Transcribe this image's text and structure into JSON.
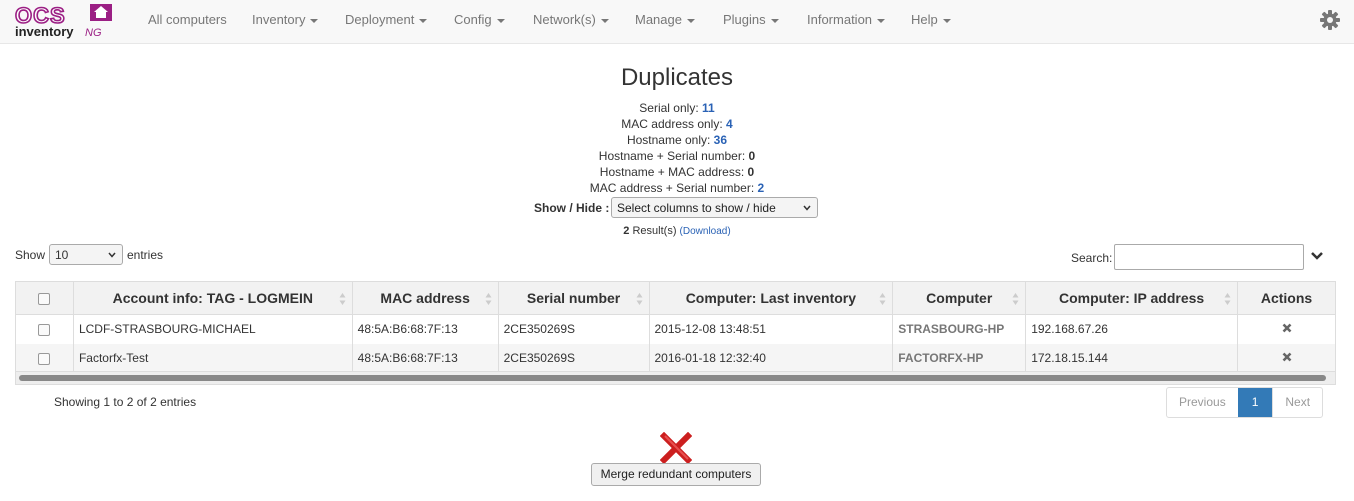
{
  "nav": {
    "logo_text_1": "OCS",
    "logo_text_2": "inventory",
    "logo_text_3": "NG",
    "items": [
      {
        "label": "All computers",
        "dropdown": false
      },
      {
        "label": "Inventory",
        "dropdown": true
      },
      {
        "label": "Deployment",
        "dropdown": true
      },
      {
        "label": "Config",
        "dropdown": true
      },
      {
        "label": "Network(s)",
        "dropdown": true
      },
      {
        "label": "Manage",
        "dropdown": true
      },
      {
        "label": "Plugins",
        "dropdown": true
      },
      {
        "label": "Information",
        "dropdown": true
      },
      {
        "label": "Help",
        "dropdown": true
      }
    ],
    "settings_icon": "gear-icon"
  },
  "page": {
    "title": "Duplicates",
    "stats": [
      {
        "label": "Serial only: ",
        "value": "11",
        "link": true
      },
      {
        "label": "MAC address only: ",
        "value": "4",
        "link": true
      },
      {
        "label": "Hostname only: ",
        "value": "36",
        "link": true
      },
      {
        "label": "Hostname + Serial number: ",
        "value": "0",
        "link": false
      },
      {
        "label": "Hostname + MAC address: ",
        "value": "0",
        "link": false
      },
      {
        "label": "MAC address + Serial number: ",
        "value": "2",
        "link": true
      }
    ],
    "show_hide_label": "Show / Hide :",
    "show_hide_select": "Select columns to show / hide",
    "results_count": "2",
    "results_label": " Result(s) ",
    "download_label": "(Download)"
  },
  "table_controls": {
    "show_label": "Show",
    "entries_value": "10",
    "entries_label": "entries",
    "search_label": "Search:"
  },
  "table": {
    "headers": [
      "Account info: TAG - LOGMEIN",
      "MAC address",
      "Serial number",
      "Computer: Last inventory",
      "Computer",
      "Computer: IP address",
      "Actions"
    ],
    "rows": [
      {
        "account": "LCDF-STRASBOURG-MICHAEL",
        "mac": "48:5A:B6:68:7F:13",
        "serial": "2CE350269S",
        "last_inventory": "2015-12-08 13:48:51",
        "computer": "STRASBOURG-HP",
        "ip": "192.168.67.26"
      },
      {
        "account": "Factorfx-Test",
        "mac": "48:5A:B6:68:7F:13",
        "serial": "2CE350269S",
        "last_inventory": "2016-01-18 12:32:40",
        "computer": "FACTORFX-HP",
        "ip": "172.18.15.144"
      }
    ]
  },
  "footer": {
    "info": "Showing 1 to 2 of 2 entries",
    "prev_label": "Previous",
    "page_label": "1",
    "next_label": "Next",
    "merge_label": "Merge redundant computers"
  },
  "colors": {
    "accent": "#337ab7",
    "link": "#2a62b5",
    "logo": "#9b1f84",
    "delete_red": "#cc1f1f"
  }
}
